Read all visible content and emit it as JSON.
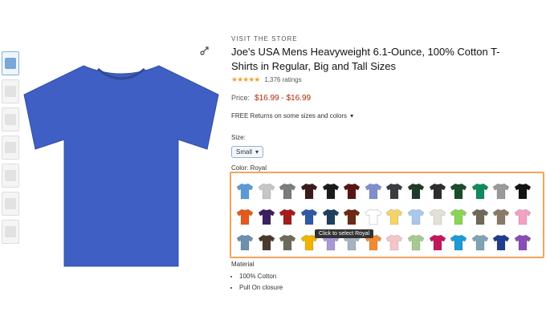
{
  "thumbnails": [
    {
      "label": "thumbnail 1",
      "active": true
    },
    {
      "label": "thumbnail 2",
      "active": false
    },
    {
      "label": "thumbnail 3",
      "active": false
    },
    {
      "label": "thumbnail 4",
      "active": false
    },
    {
      "label": "thumbnail 5",
      "active": false
    },
    {
      "label": "thumbnail 6",
      "active": false
    },
    {
      "label": "thumbnail 7",
      "active": false
    }
  ],
  "product": {
    "brand": "VISIT THE STORE",
    "title": "Joe's USA Mens Heavyweight 6.1-Ounce, 100% Cotton T-Shirts in Regular, Big and Tall Sizes",
    "rating_count": "1,376 ratings",
    "price_label": "Price:",
    "price_range": "$16.99 - $16.99",
    "returns_text": "FREE Returns on some sizes and colors"
  },
  "size": {
    "label": "Size:",
    "selected": "Small"
  },
  "color": {
    "label": "Color: Royal",
    "tooltip": "Click to select Royal",
    "swatches": [
      "#5b9bd5",
      "#c6c6c6",
      "#7c7c7c",
      "#3b1c1c",
      "#1b1b1b",
      "#5a1414",
      "#7f8fce",
      "#3a3d40",
      "#1e3b2a",
      "#2b2d2f",
      "#1c4d2b",
      "#138a5c",
      "#9a9a9a",
      "#131313",
      "#e35b1c",
      "#3b1f5f",
      "#a51b1b",
      "#2d5aa8",
      "#1f3f5f",
      "#6b2b16",
      "#ffffff",
      "#f3d36b",
      "#a9c8ee",
      "#e4e0d6",
      "#8ad455",
      "#6e6a58",
      "#8a7a6a",
      "#f2a0c4",
      "#6e8fad",
      "#4a3a2e",
      "#6c6a5a",
      "#f0b400",
      "#a997d6",
      "#a3b3bf",
      "#f18a34",
      "#f4c6c8",
      "#a7c98f",
      "#c2185b",
      "#1e9ad6",
      "#7fa3b4",
      "#1f3e8a",
      "#8a4db3"
    ]
  },
  "details": {
    "heading": "Material",
    "bullets": [
      "100% Cotton",
      "Pull On closure"
    ]
  },
  "colors": {
    "accent_border": "#f2a65a",
    "shirt": "#3f5fc4",
    "price": "#b12704"
  }
}
